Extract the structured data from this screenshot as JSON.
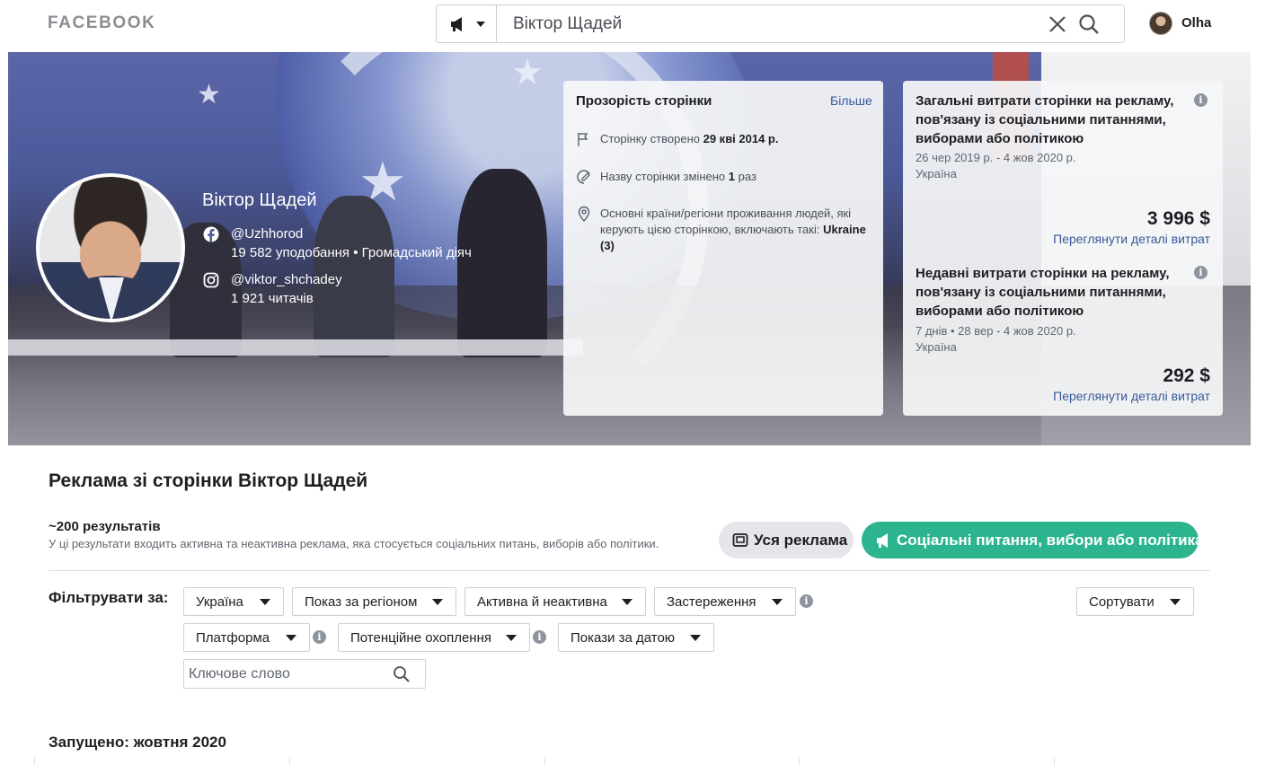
{
  "header": {
    "logo": "FACEBOOK",
    "search_value": "Віктор Щадей",
    "search_type_icon": "megaphone-icon",
    "user_name": "Olha"
  },
  "page": {
    "name": "Віктор Щадей",
    "facebook_handle": "@Uzhhorod",
    "facebook_meta": "19 582 уподобання • Громадський діяч",
    "instagram_handle": "@viktor_shchadey",
    "instagram_meta": "1 921 читачів"
  },
  "transparency": {
    "title": "Прозорість сторінки",
    "more": "Більше",
    "created_prefix": "Сторінку створено",
    "created_value": "29 кві 2014 р.",
    "renamed_prefix": "Назву сторінки змінено",
    "renamed_value": "1",
    "renamed_suffix": "раз",
    "countries_text": "Основні країни/регіони проживання людей, які керують цією сторінкою, включають такі:",
    "countries_value": "Ukraine (3)"
  },
  "spending": {
    "total": {
      "title": "Загальні витрати сторінки на рекламу, пов'язану із соціальними питаннями, виборами або політикою",
      "period": "26 чер 2019 р. - 4 жов 2020 р.",
      "country": "Україна",
      "amount": "3 996 $",
      "link": "Переглянути деталі витрат"
    },
    "recent": {
      "title": "Недавні витрати сторінки на рекламу, пов'язану із соціальними питаннями, виборами або політикою",
      "period": "7 днів • 28 вер - 4 жов 2020 р.",
      "country": "Україна",
      "amount": "292 $",
      "link": "Переглянути деталі витрат"
    }
  },
  "ads": {
    "title": "Реклама зі сторінки Віктор Щадей",
    "results_count": "~200 результатів",
    "results_desc": "У ці результати входить активна та неактивна реклама, яка стосується соціальних питань, виборів або політики.",
    "btn_all": "Уся реклама",
    "btn_social": "Соціальні питання, вибори або політика",
    "filter_label": "Фільтрувати за:",
    "filters": {
      "country": "Україна",
      "region": "Показ за регіоном",
      "status": "Активна й неактивна",
      "disclaimer": "Застереження",
      "sort": "Сортувати",
      "platform": "Платформа",
      "reach": "Потенційне охоплення",
      "date": "Покази за датою"
    },
    "keyword_placeholder": "Ключове слово",
    "launched": "Запущено: жовтня 2020"
  },
  "colors": {
    "link": "#385898",
    "accent_green": "#2cb48f",
    "logo_grey": "#8a8d91"
  }
}
